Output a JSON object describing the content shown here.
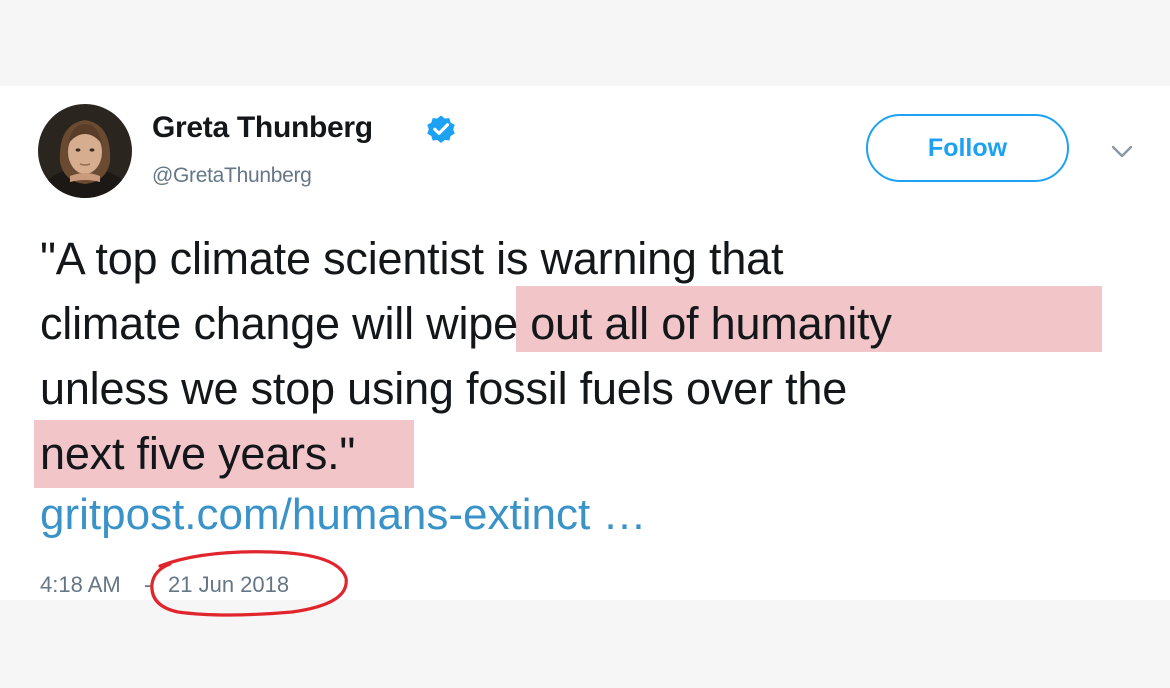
{
  "user": {
    "display_name": "Greta Thunberg",
    "handle": "@GretaThunberg",
    "verified_icon": "verified-badge-icon"
  },
  "actions": {
    "follow_label": "Follow",
    "more_icon": "chevron-down-icon"
  },
  "tweet": {
    "lines": [
      "\"A top climate scientist is warning that",
      "climate change will wipe out all of humanity",
      "unless we stop using fossil fuels over the",
      "next five years.\""
    ],
    "link": "gritpost.com/humans-extinct …",
    "time": "4:18 AM",
    "separator": "-",
    "date": "21 Jun 2018"
  },
  "colors": {
    "accent": "#1da1f2",
    "link": "#3a93c8",
    "highlight": "#f2c5c9",
    "annotation": "#e0262c"
  }
}
